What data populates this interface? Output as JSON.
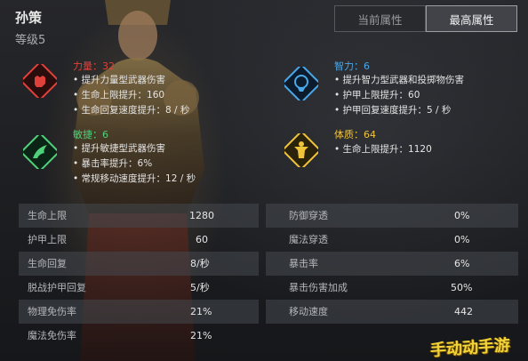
{
  "hero": {
    "name": "孙策",
    "level": "等级5"
  },
  "tabs": [
    {
      "label": "当前属性",
      "active": false
    },
    {
      "label": "最高属性",
      "active": true
    }
  ],
  "colors": {
    "strength": "#e0403a",
    "agility": "#4fd07a",
    "intellect": "#4aa7e8",
    "constitution": "#f0c43a"
  },
  "attributes": {
    "strength": {
      "name": "力量：32",
      "icon": "strength-fist-icon",
      "lines": [
        "提升力量型武器伤害",
        "生命上限提升：160",
        "生命回复速度提升：8 / 秒"
      ]
    },
    "agility": {
      "name": "敏捷：6",
      "icon": "agility-wing-icon",
      "lines": [
        "提升敏捷型武器伤害",
        "暴击率提升：6%",
        "常规移动速度提升：12 / 秒"
      ]
    },
    "intellect": {
      "name": "智力：6",
      "icon": "intellect-brain-icon",
      "lines": [
        "提升智力型武器和投掷物伤害",
        "护甲上限提升：60",
        "护甲回复速度提升：5 / 秒"
      ]
    },
    "constitution": {
      "name": "体质：64",
      "icon": "constitution-body-icon",
      "lines": [
        "生命上限提升：1120"
      ]
    }
  },
  "stats": {
    "left": [
      {
        "label": "生命上限",
        "value": "1280"
      },
      {
        "label": "护甲上限",
        "value": "60"
      },
      {
        "label": "生命回复",
        "value": "8/秒"
      },
      {
        "label": "脱战护甲回复",
        "value": "5/秒"
      },
      {
        "label": "物理免伤率",
        "value": "21%"
      },
      {
        "label": "魔法免伤率",
        "value": "21%"
      }
    ],
    "right": [
      {
        "label": "防御穿透",
        "value": "0%"
      },
      {
        "label": "魔法穿透",
        "value": "0%"
      },
      {
        "label": "暴击率",
        "value": "6%"
      },
      {
        "label": "暴击伤害加成",
        "value": "50%"
      },
      {
        "label": "移动速度",
        "value": "442"
      }
    ]
  },
  "watermark": "手动动手游"
}
